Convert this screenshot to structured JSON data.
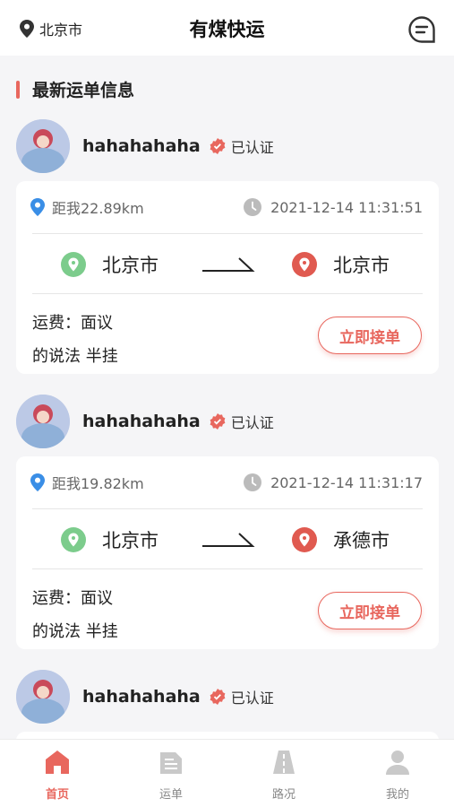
{
  "header": {
    "location": "北京市",
    "title": "有煤快运"
  },
  "section": {
    "title": "最新运单信息"
  },
  "verified_label": "已认证",
  "accept_label": "立即接单",
  "orders": [
    {
      "user": "hahahahaha",
      "distance": "距我22.89km",
      "time": "2021-12-14 11:31:51",
      "from": "北京市",
      "to": "北京市",
      "fee": "运费：面议",
      "desc": "的说法 半挂"
    },
    {
      "user": "hahahahaha",
      "distance": "距我19.82km",
      "time": "2021-12-14 11:31:17",
      "from": "北京市",
      "to": "承德市",
      "fee": "运费：面议",
      "desc": "的说法 半挂"
    },
    {
      "user": "hahahahaha"
    }
  ],
  "tabs": [
    {
      "label": "首页",
      "icon": "home-icon",
      "active": true
    },
    {
      "label": "运单",
      "icon": "waybill-icon",
      "active": false
    },
    {
      "label": "路况",
      "icon": "road-icon",
      "active": false
    },
    {
      "label": "我的",
      "icon": "profile-icon",
      "active": false
    }
  ],
  "colors": {
    "accent": "#e8675e",
    "origin": "#7ccc8c",
    "destination": "#e05a50",
    "distance_pin": "#3a8ee6"
  }
}
